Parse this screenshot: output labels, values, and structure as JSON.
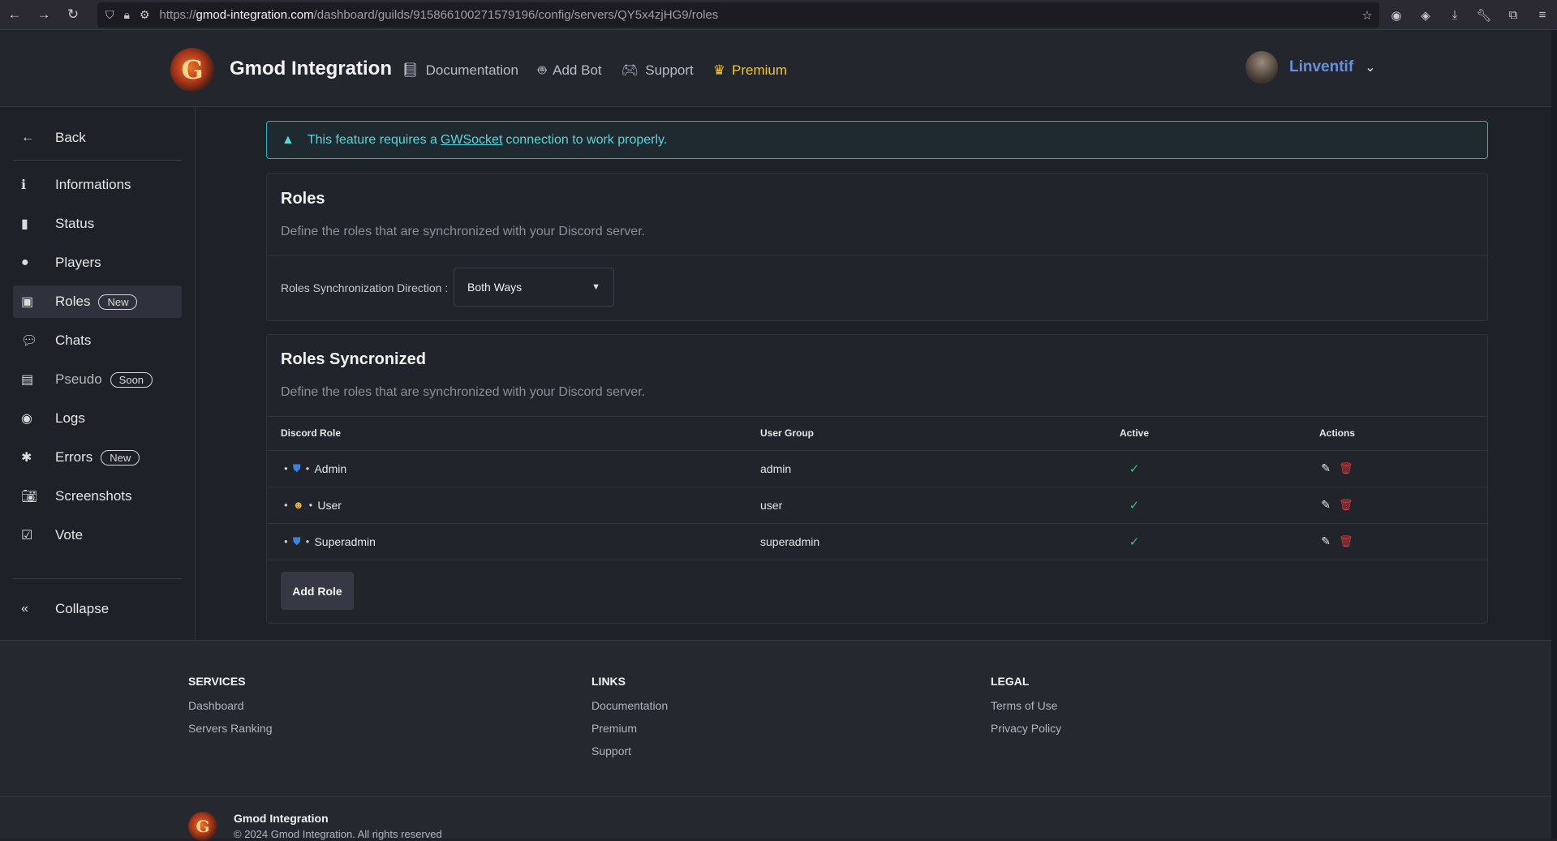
{
  "browser": {
    "url_prefix": "https://",
    "url_host": "gmod-integration.com",
    "url_path": "/dashboard/guilds/915866100271579196/config/servers/QY5x4zjHG9/roles"
  },
  "header": {
    "brand": "Gmod Integration",
    "logo_letter": "G",
    "menu": [
      {
        "label": "Documentation",
        "icon": "book-icon"
      },
      {
        "label": "Add Bot",
        "icon": "robot-icon"
      },
      {
        "label": "Support",
        "icon": "discord-icon"
      },
      {
        "label": "Premium",
        "icon": "crown-icon"
      }
    ],
    "username": "Linventif"
  },
  "sidebar": {
    "back": "Back",
    "items": [
      {
        "label": "Informations",
        "icon": "info-icon",
        "badge": ""
      },
      {
        "label": "Status",
        "icon": "bar-chart-icon",
        "badge": ""
      },
      {
        "label": "Players",
        "icon": "user-icon",
        "badge": ""
      },
      {
        "label": "Roles",
        "icon": "id-card-icon",
        "badge": "New"
      },
      {
        "label": "Chats",
        "icon": "comments-icon",
        "badge": ""
      },
      {
        "label": "Pseudo",
        "icon": "address-card-icon",
        "badge": "Soon"
      },
      {
        "label": "Logs",
        "icon": "eye-icon",
        "badge": ""
      },
      {
        "label": "Errors",
        "icon": "bug-icon",
        "badge": "New"
      },
      {
        "label": "Screenshots",
        "icon": "camera-icon",
        "badge": ""
      },
      {
        "label": "Vote",
        "icon": "vote-icon",
        "badge": ""
      }
    ],
    "collapse": "Collapse"
  },
  "alert": {
    "before": "This feature requires a",
    "link": "GWSocket",
    "after": "connection to work properly."
  },
  "roles_card": {
    "title": "Roles",
    "description": "Define the roles that are synchronized with your Discord server.",
    "direction_label": "Roles Synchronization Direction :",
    "direction_value": "Both Ways"
  },
  "sync_card": {
    "title": "Roles Syncronized",
    "description": "Define the roles that are synchronized with your Discord server.",
    "columns": [
      "Discord Role",
      "User Group",
      "Active",
      "Actions"
    ],
    "rows": [
      {
        "role": "Admin",
        "icon": "shield-icon",
        "group": "admin"
      },
      {
        "role": "User",
        "icon": "emoji-icon",
        "group": "user"
      },
      {
        "role": "Superadmin",
        "icon": "shield-icon",
        "group": "superadmin"
      }
    ],
    "add_button": "Add Role"
  },
  "footer": {
    "columns": [
      {
        "title": "SERVICES",
        "links": [
          "Dashboard",
          "Servers Ranking"
        ]
      },
      {
        "title": "LINKS",
        "links": [
          "Documentation",
          "Premium",
          "Support"
        ]
      },
      {
        "title": "LEGAL",
        "links": [
          "Terms of Use",
          "Privacy Policy"
        ]
      }
    ],
    "brand": "Gmod Integration",
    "copyright": "© 2024 Gmod Integration. All rights reserved"
  },
  "colors": {
    "accent": "#6a8fd8",
    "premium": "#f4c430",
    "alert": "#5fd4d8",
    "success": "#3cc26b",
    "danger": "#d9363e"
  }
}
